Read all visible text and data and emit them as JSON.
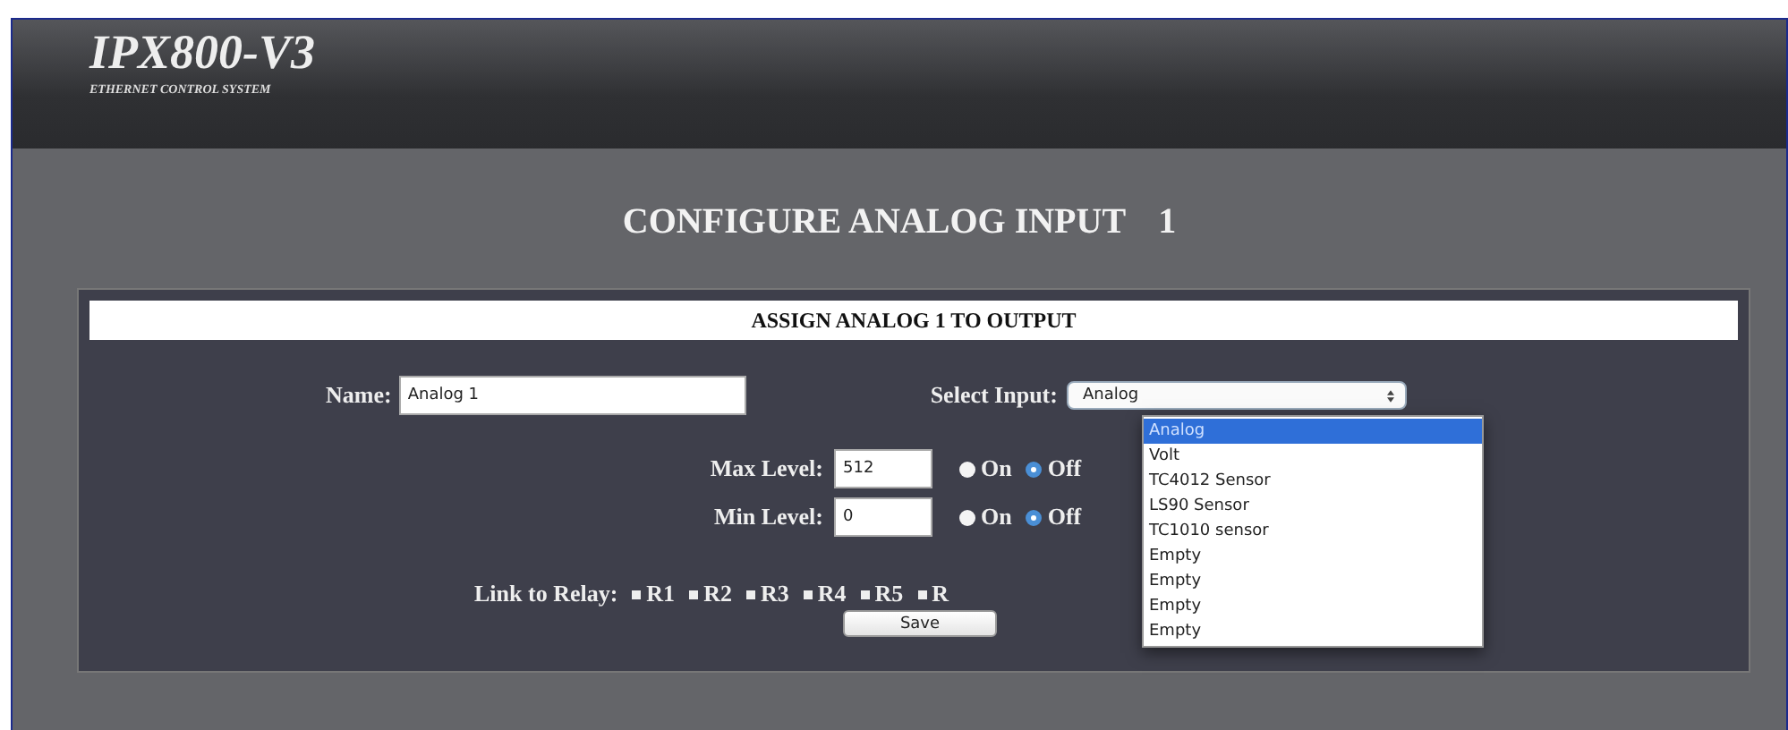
{
  "header": {
    "title": "IPX800-V3",
    "subtitle": "ETHERNET CONTROL SYSTEM"
  },
  "page_title": "CONFIGURE ANALOG INPUT",
  "page_number": "1",
  "panel": {
    "title": "ASSIGN ANALOG 1 TO OUTPUT",
    "name_label": "Name:",
    "name_value": "Analog 1",
    "select_label": "Select Input:",
    "select_value": "Analog",
    "options": [
      {
        "label": "Analog",
        "selected": true
      },
      {
        "label": "Volt",
        "selected": false
      },
      {
        "label": "TC4012 Sensor",
        "selected": false
      },
      {
        "label": "LS90 Sensor",
        "selected": false
      },
      {
        "label": "TC1010 sensor",
        "selected": false
      },
      {
        "label": "Empty",
        "selected": false
      },
      {
        "label": "Empty",
        "selected": false
      },
      {
        "label": "Empty",
        "selected": false
      },
      {
        "label": "Empty",
        "selected": false
      }
    ],
    "levels": [
      {
        "label": "Max Level:",
        "value": "512",
        "radios": [
          {
            "label": "On",
            "selected": false
          },
          {
            "label": "Off",
            "selected": true
          }
        ]
      },
      {
        "label": "Min Level:",
        "value": "0",
        "radios": [
          {
            "label": "On",
            "selected": false
          },
          {
            "label": "Off",
            "selected": true
          }
        ]
      }
    ],
    "relay_label": "Link to Relay:",
    "relays": [
      {
        "label": "R1",
        "checked": false
      },
      {
        "label": "R2",
        "checked": false
      },
      {
        "label": "R3",
        "checked": false
      },
      {
        "label": "R4",
        "checked": false
      },
      {
        "label": "R5",
        "checked": false
      },
      {
        "label": "R",
        "checked": false
      }
    ],
    "save": "Save"
  }
}
